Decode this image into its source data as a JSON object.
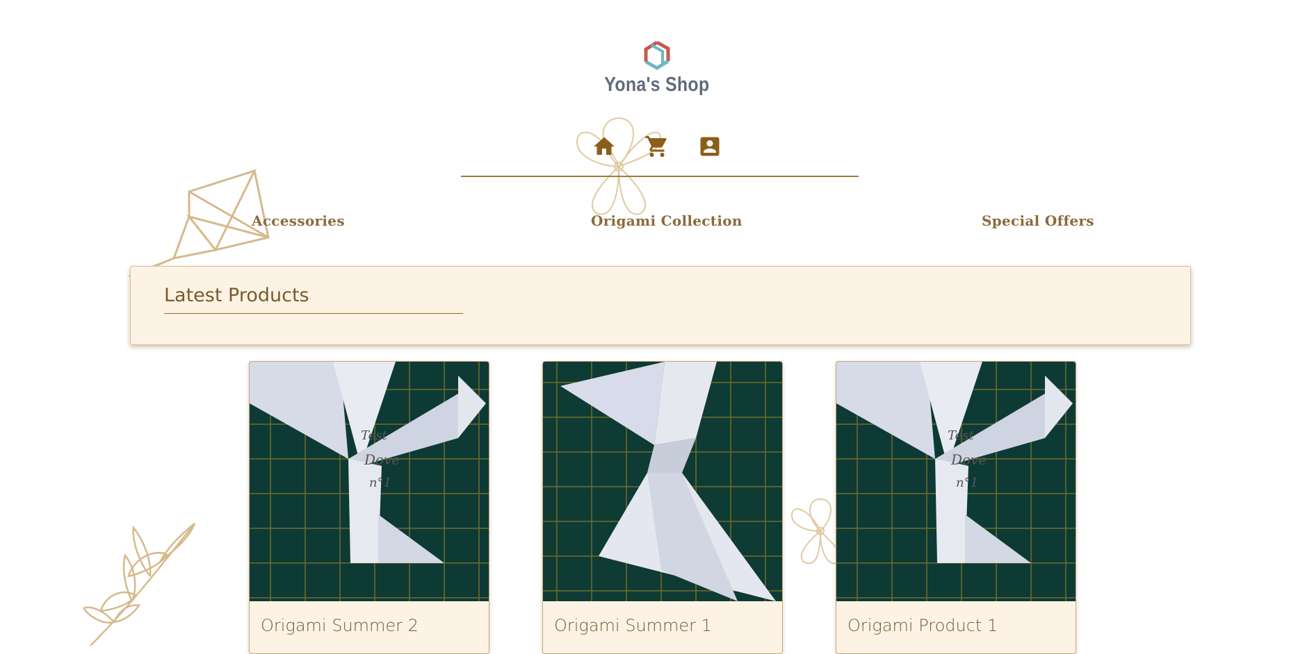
{
  "brand": {
    "name": "Yona's Shop"
  },
  "nav": {
    "icons": [
      "home-icon",
      "cart-icon",
      "account-icon"
    ]
  },
  "categories": [
    "Accessories",
    "Origami Collection",
    "Special Offers"
  ],
  "latest": {
    "title": "Latest Products"
  },
  "products": [
    {
      "title": "Origami Summer 2"
    },
    {
      "title": "Origami Summer 1"
    },
    {
      "title": "Origami Product 1"
    }
  ],
  "colors": {
    "accent": "#8b5e1a",
    "card_bg": "#fdf3e4",
    "brand_text": "#5f6c7b",
    "logo_red": "#c9584a",
    "logo_teal": "#6bb8c4"
  }
}
